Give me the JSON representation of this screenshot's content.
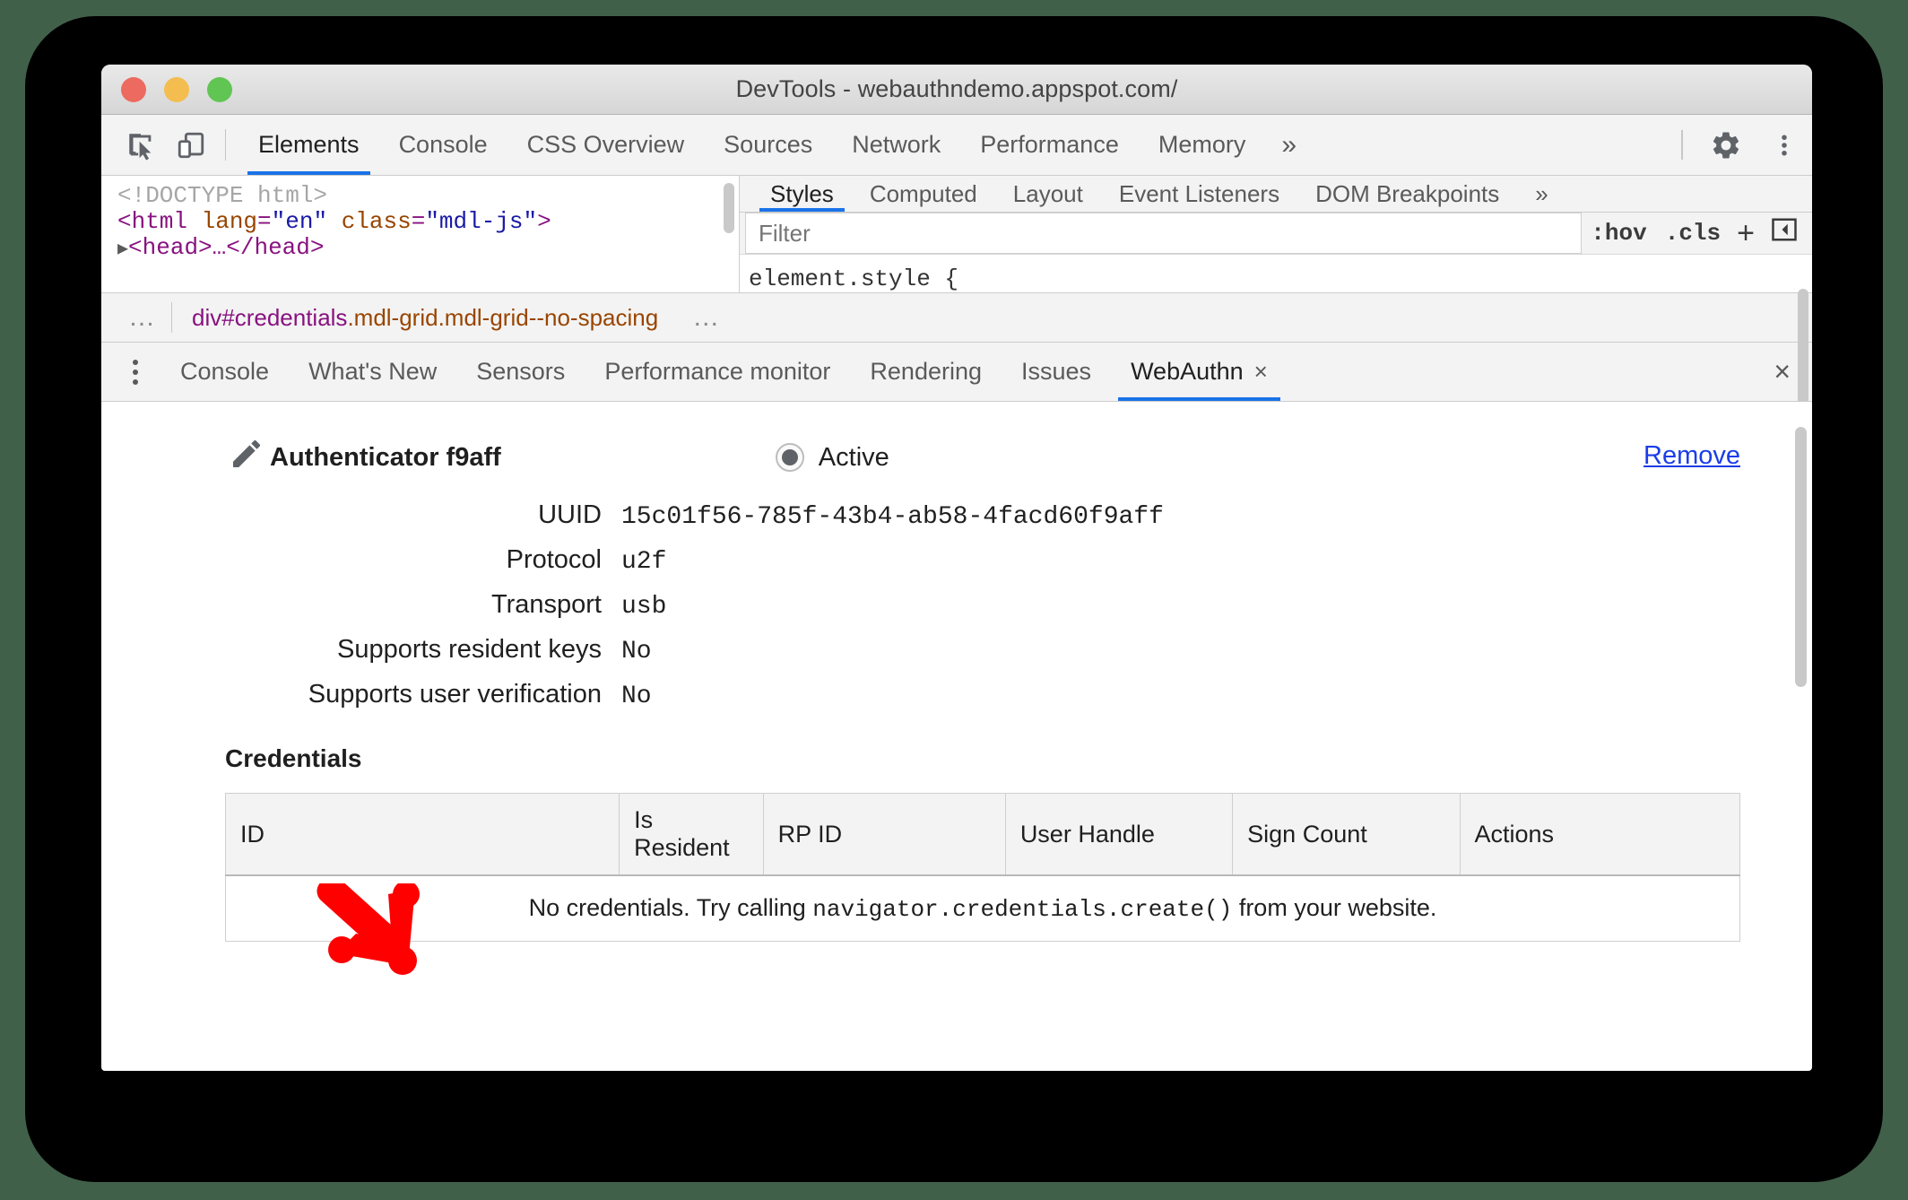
{
  "window": {
    "title": "DevTools - webauthndemo.appspot.com/"
  },
  "toolbar": {
    "inspect_icon": "inspect-cursor-icon",
    "device_icon": "device-toolbar-icon",
    "tabs": [
      {
        "label": "Elements",
        "active": true
      },
      {
        "label": "Console",
        "active": false
      },
      {
        "label": "CSS Overview",
        "active": false
      },
      {
        "label": "Sources",
        "active": false
      },
      {
        "label": "Network",
        "active": false
      },
      {
        "label": "Performance",
        "active": false
      },
      {
        "label": "Memory",
        "active": false
      }
    ],
    "more_tabs": "»",
    "settings_icon": "gear-icon",
    "menu_icon": "kebab-menu-icon"
  },
  "elements_tree": {
    "lines": [
      {
        "text": "<!DOCTYPE html>"
      },
      {
        "text": "<html lang=\"en\" class=\"mdl-js\">"
      },
      {
        "text": "<head>…</head>"
      }
    ],
    "doctype": "<!DOCTYPE html>",
    "html_open_tag": "<html",
    "attr1_name": "lang",
    "attr1_value": "\"en\"",
    "attr2_name": "class",
    "attr2_value": "\"mdl-js\"",
    "html_close_bracket": ">",
    "head_line": "<head>…</head>",
    "expand_arrow": "▶"
  },
  "styles_pane": {
    "tabs": [
      {
        "label": "Styles",
        "active": true
      },
      {
        "label": "Computed",
        "active": false
      },
      {
        "label": "Layout",
        "active": false
      },
      {
        "label": "Event Listeners",
        "active": false
      },
      {
        "label": "DOM Breakpoints",
        "active": false
      }
    ],
    "more_tabs": "»",
    "filter_placeholder": "Filter",
    "filter_value": "",
    "hov_button": ":hov",
    "cls_button": ".cls",
    "new_rule_button": "+",
    "sidebar_toggle_icon": "toggle-sidebar-icon",
    "element_style": "element.style {"
  },
  "breadcrumb": {
    "overflow_left": "…",
    "node_name": "div#credentials",
    "node_classes": ".mdl-grid.mdl-grid--no-spacing",
    "overflow_right": "…"
  },
  "drawer": {
    "menu_icon": "kebab-menu-icon",
    "tabs": [
      {
        "label": "Console",
        "active": false,
        "closable": false
      },
      {
        "label": "What's New",
        "active": false,
        "closable": false
      },
      {
        "label": "Sensors",
        "active": false,
        "closable": false
      },
      {
        "label": "Performance monitor",
        "active": false,
        "closable": false
      },
      {
        "label": "Rendering",
        "active": false,
        "closable": false
      },
      {
        "label": "Issues",
        "active": false,
        "closable": false
      },
      {
        "label": "WebAuthn",
        "active": true,
        "closable": true,
        "close_glyph": "×"
      }
    ],
    "close_drawer_glyph": "×"
  },
  "webauthn": {
    "edit_icon": "pencil-icon",
    "authenticator_title": "Authenticator f9aff",
    "state_label": "Active",
    "state_selected": true,
    "remove_label": "Remove",
    "fields": [
      {
        "label": "UUID",
        "value": "15c01f56-785f-43b4-ab58-4facd60f9aff"
      },
      {
        "label": "Protocol",
        "value": "u2f"
      },
      {
        "label": "Transport",
        "value": "usb"
      },
      {
        "label": "Supports resident keys",
        "value": "No"
      },
      {
        "label": "Supports user verification",
        "value": "No"
      }
    ],
    "credentials": {
      "section_title": "Credentials",
      "columns": [
        "ID",
        "Is Resident",
        "RP ID",
        "User Handle",
        "Sign Count",
        "Actions"
      ],
      "rows": [],
      "empty_text_before": "No credentials. Try calling ",
      "empty_text_code": "navigator.credentials.create()",
      "empty_text_after": " from your website."
    }
  },
  "annotation": {
    "arrow_color": "#ff0000",
    "arrow_name": "red-annotation-arrow"
  },
  "colors": {
    "accent": "#1a73e8",
    "link": "#1a3de8",
    "backdrop": "#000000",
    "page_background": "#41604a"
  }
}
